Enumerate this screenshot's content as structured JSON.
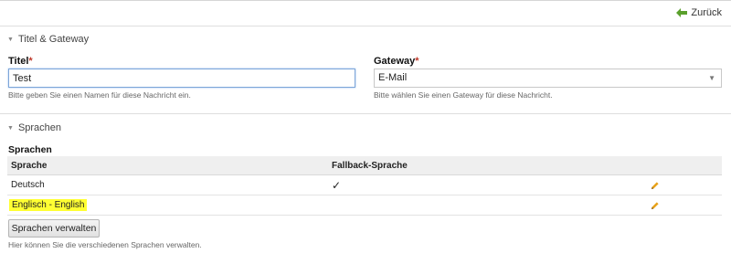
{
  "header": {
    "back_label": "Zurück"
  },
  "sections": {
    "title_gateway": {
      "heading": "Titel & Gateway",
      "title_field": {
        "label": "Titel",
        "required_mark": "*",
        "value": "Test",
        "help": "Bitte geben Sie einen Namen für diese Nachricht ein."
      },
      "gateway_field": {
        "label": "Gateway",
        "required_mark": "*",
        "selected": "E-Mail",
        "help": "Bitte wählen Sie einen Gateway für diese Nachricht."
      }
    },
    "languages": {
      "heading": "Sprachen",
      "subheading": "Sprachen",
      "table": {
        "headers": [
          "Sprache",
          "Fallback-Sprache",
          ""
        ],
        "rows": [
          {
            "language": "Deutsch",
            "fallback": "✓",
            "highlighted": false
          },
          {
            "language": "Englisch - English",
            "fallback": "",
            "highlighted": true
          }
        ]
      },
      "manage_button": "Sprachen verwalten",
      "help": "Hier können Sie die verschiedenen Sprachen verwalten."
    }
  },
  "colors": {
    "accent_green": "#5aa02c",
    "required_red": "#c0392b",
    "highlight_yellow": "#ffff33",
    "edit_icon_orange": "#e8a21a"
  },
  "icons": {
    "back": "arrow-left-icon",
    "collapse": "triangle-down-icon",
    "select_caret": "caret-down-icon",
    "check": "checkmark-icon",
    "edit": "pencil-icon"
  }
}
